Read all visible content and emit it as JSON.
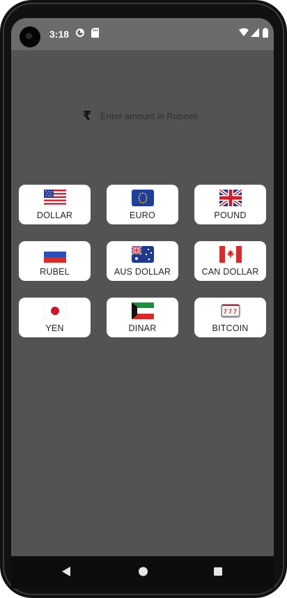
{
  "status_bar": {
    "time": "3:18",
    "left_icons": [
      "data-saver-icon",
      "sd-card-icon"
    ],
    "right_icons": [
      "wifi-icon",
      "cell-signal-icon",
      "battery-icon"
    ]
  },
  "amount_input": {
    "currency_symbol": "₹",
    "placeholder": "Enter amount in Rupees",
    "value": ""
  },
  "currencies": [
    {
      "label": "DOLLAR",
      "icon": "us-flag-icon"
    },
    {
      "label": "EURO",
      "icon": "eu-flag-icon"
    },
    {
      "label": "POUND",
      "icon": "uk-flag-icon"
    },
    {
      "label": "RUBEL",
      "icon": "russia-flag-icon"
    },
    {
      "label": "AUS DOLLAR",
      "icon": "australia-flag-icon"
    },
    {
      "label": "CAN DOLLAR",
      "icon": "canada-flag-icon"
    },
    {
      "label": "YEN",
      "icon": "japan-flag-icon"
    },
    {
      "label": "DINAR",
      "icon": "kuwait-flag-icon"
    },
    {
      "label": "BITCOIN",
      "icon": "slot-machine-icon"
    }
  ],
  "nav_bar": [
    "back-icon",
    "home-icon",
    "recents-icon"
  ],
  "colors": {
    "screen_background": "#535353",
    "status_bar": "#6b6b6b",
    "card": "#ffffff",
    "nav_bar": "#0d0d0d"
  }
}
